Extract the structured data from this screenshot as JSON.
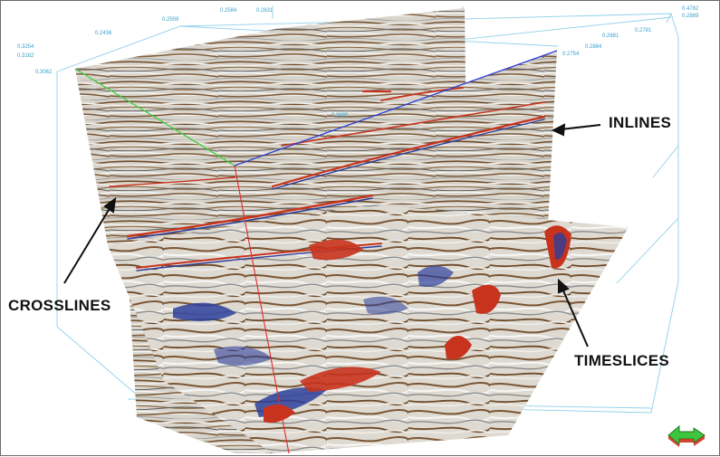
{
  "labels": {
    "inlines": "INLINES",
    "crosslines": "CROSSLINES",
    "timeslices": "TIMESLICES"
  },
  "axis_ticks": {
    "left_top": "0.3254",
    "left_second": "0.3162",
    "left_third": "0.3062",
    "top_1": "0.2436",
    "top_2": "0.2509",
    "top_3": "0.2584",
    "top_4": "0.2631",
    "top_5": "0.2781",
    "top_6": "0.2681",
    "right_1": "0.2754",
    "right_2": "0.2884",
    "right_far_1": "0.4782",
    "right_far_2": "0.2889",
    "mid_1": "0.3885"
  },
  "colors": {
    "frame_lines": "#8fd0ea",
    "crossline_axis": "#3ecf3e",
    "inline_axis": "#2a3fd6",
    "vertical_axis": "#e02a2a",
    "seismic_red": "#c8331d",
    "seismic_blue": "#2e3f9a",
    "seismic_brown": "#6e4a28",
    "seismic_gray": "#d9d6cf"
  },
  "nav_widget_icon": "3d-orientation-arrow-icon"
}
